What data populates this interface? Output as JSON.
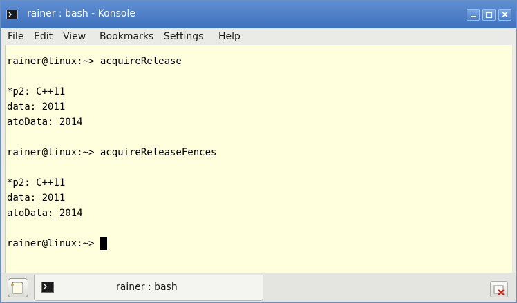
{
  "window": {
    "title": "rainer : bash - Konsole",
    "icon": "terminal-icon",
    "controls": [
      "minimize-icon",
      "maximize-icon",
      "close-icon"
    ]
  },
  "menu": {
    "items": [
      "File",
      "Edit",
      "View",
      "Bookmarks",
      "Settings",
      "Help"
    ]
  },
  "terminal": {
    "lines": [
      "rainer@linux:~> acquireRelease",
      "",
      "*p2: C++11",
      "data: 2011",
      "atoData: 2014",
      "",
      "rainer@linux:~> acquireReleaseFences",
      "",
      "*p2: C++11",
      "data: 2011",
      "atoData: 2014",
      "",
      "rainer@linux:~> "
    ],
    "background": "#ffffdd",
    "foreground": "#000000"
  },
  "tabs": {
    "items": [
      {
        "label": "rainer : bash",
        "icon": "terminal-icon"
      }
    ],
    "new_tab_icon": "new-tab-icon",
    "close_tab_icon": "close-tab-icon"
  },
  "colors": {
    "titlebar": "#4a7cc6",
    "terminal_bg": "#ffffdd"
  }
}
